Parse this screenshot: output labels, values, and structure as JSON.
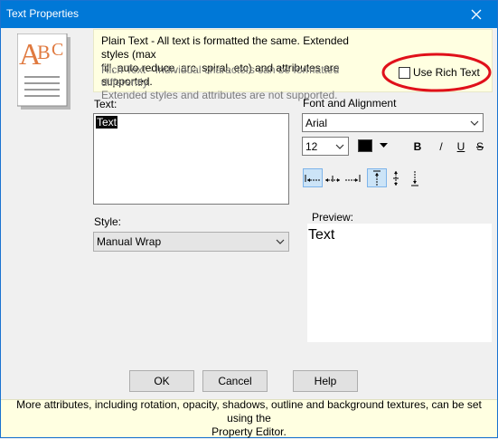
{
  "window": {
    "title": "Text Properties"
  },
  "info": {
    "plain_line1": "Plain Text - All text is formatted the same.  Extended styles (max",
    "plain_line2": "fill, auto reduce, arc, spiral, etc) and attributes are supported.",
    "rich_line1": "Rich Text - Individual characters can be formatted differently.",
    "rich_line2": "Extended styles and attributes are not supported.",
    "use_rich_text_label": "Use Rich Text",
    "use_rich_text_checked": false
  },
  "text_section": {
    "label": "Text:",
    "value": "Text"
  },
  "style": {
    "label": "Style:",
    "selected": "Manual Wrap"
  },
  "font": {
    "label": "Font and Alignment",
    "family": "Arial",
    "size": "12",
    "color": "#000000",
    "bold_label": "B",
    "italic_label": "/",
    "underline_label": "U",
    "strike_label": "S"
  },
  "alignment": {
    "horizontal": [
      "align-left",
      "align-center",
      "align-right"
    ],
    "vertical": [
      "align-top",
      "align-middle",
      "align-bottom"
    ],
    "active_horizontal": "align-left",
    "active_vertical": "align-top"
  },
  "preview": {
    "label": "Preview:",
    "text": "Text"
  },
  "buttons": {
    "ok": "OK",
    "cancel": "Cancel",
    "help": "Help"
  },
  "footer": {
    "line1": "More attributes, including rotation, opacity, shadows, outline and background textures, can be set using the",
    "line2": "Property Editor."
  },
  "colors": {
    "titlebar": "#0078d7",
    "info_bg": "#ffffe1",
    "highlight_ring": "#e0101a"
  }
}
